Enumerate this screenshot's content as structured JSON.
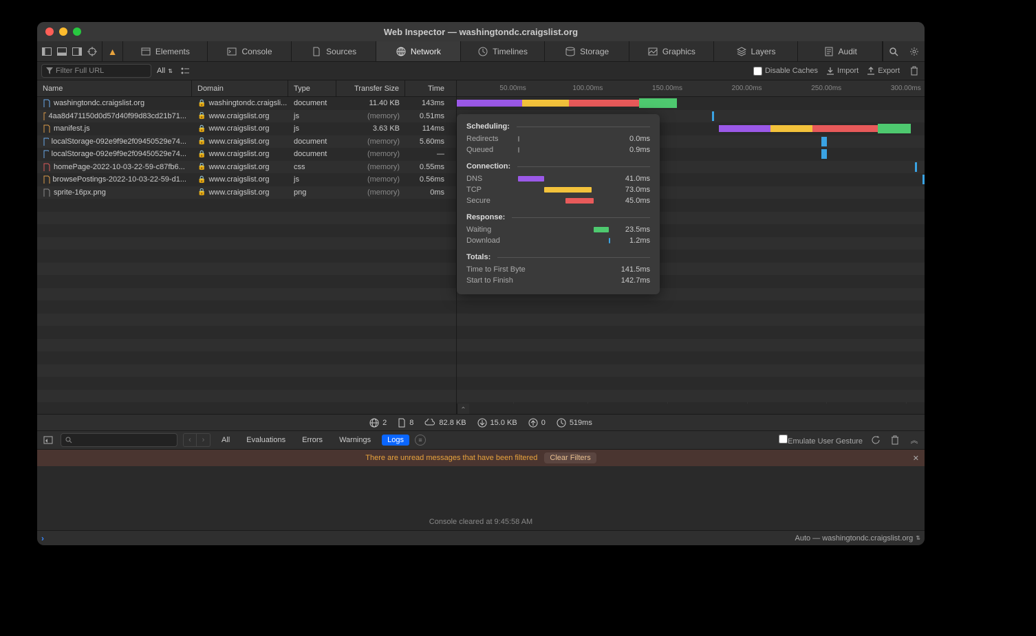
{
  "window_title": "Web Inspector — washingtondc.craigslist.org",
  "tabs": [
    "Elements",
    "Console",
    "Sources",
    "Network",
    "Timelines",
    "Storage",
    "Graphics",
    "Layers",
    "Audit"
  ],
  "active_tab": "Network",
  "filter_placeholder": "Filter Full URL",
  "filter_all": "All",
  "disable_caches": "Disable Caches",
  "import_label": "Import",
  "export_label": "Export",
  "columns": {
    "name": "Name",
    "domain": "Domain",
    "type": "Type",
    "size": "Transfer Size",
    "time": "Time"
  },
  "ticks": [
    "50.00ms",
    "100.00ms",
    "150.00ms",
    "200.00ms",
    "250.00ms",
    "300.00ms"
  ],
  "rows": [
    {
      "name": "washingtondc.craigslist.org",
      "domain": "washingtondc.craigsli...",
      "type": "document",
      "size": "11.40 KB",
      "time": "143ms",
      "mem": false,
      "fi": "doc"
    },
    {
      "name": "4aa8d471150d0d57d40f99d83cd21b71...",
      "domain": "www.craigslist.org",
      "type": "js",
      "size": "(memory)",
      "time": "0.51ms",
      "mem": true,
      "fi": "js"
    },
    {
      "name": "manifest.js",
      "domain": "www.craigslist.org",
      "type": "js",
      "size": "3.63 KB",
      "time": "114ms",
      "mem": false,
      "fi": "js"
    },
    {
      "name": "localStorage-092e9f9e2f09450529e74...",
      "domain": "www.craigslist.org",
      "type": "document",
      "size": "(memory)",
      "time": "5.60ms",
      "mem": true,
      "fi": "doc"
    },
    {
      "name": "localStorage-092e9f9e2f09450529e74...",
      "domain": "www.craigslist.org",
      "type": "document",
      "size": "(memory)",
      "time": "—",
      "mem": true,
      "fi": "doc"
    },
    {
      "name": "homePage-2022-10-03-22-59-c87fb6...",
      "domain": "www.craigslist.org",
      "type": "css",
      "size": "(memory)",
      "time": "0.55ms",
      "mem": true,
      "fi": "css"
    },
    {
      "name": "browsePostings-2022-10-03-22-59-d1...",
      "domain": "www.craigslist.org",
      "type": "js",
      "size": "(memory)",
      "time": "0.56ms",
      "mem": true,
      "fi": "js"
    },
    {
      "name": "sprite-16px.png",
      "domain": "www.craigslist.org",
      "type": "png",
      "size": "(memory)",
      "time": "0ms",
      "mem": true,
      "fi": "img"
    }
  ],
  "tooltip": {
    "scheduling": "Scheduling:",
    "redirects": "Redirects",
    "redirects_val": "0.0ms",
    "queued": "Queued",
    "queued_val": "0.9ms",
    "connection": "Connection:",
    "dns": "DNS",
    "dns_val": "41.0ms",
    "tcp": "TCP",
    "tcp_val": "73.0ms",
    "secure": "Secure",
    "secure_val": "45.0ms",
    "response": "Response:",
    "waiting": "Waiting",
    "waiting_val": "23.5ms",
    "download": "Download",
    "download_val": "1.2ms",
    "totals": "Totals:",
    "ttfb": "Time to First Byte",
    "ttfb_val": "141.5ms",
    "stf": "Start to Finish",
    "stf_val": "142.7ms"
  },
  "status": {
    "globe": "2",
    "docs": "8",
    "cloud": "82.8 KB",
    "down": "15.0 KB",
    "up": "0",
    "clock": "519ms"
  },
  "console": {
    "filters": [
      "All",
      "Evaluations",
      "Errors",
      "Warnings",
      "Logs"
    ],
    "active_filter": "Logs",
    "emulate": "Emulate User Gesture",
    "warn_msg": "There are unread messages that have been filtered",
    "clear_filters": "Clear Filters",
    "cleared_msg": "Console cleared at 9:45:58 AM",
    "footer_context": "Auto — washingtondc.craigslist.org"
  }
}
